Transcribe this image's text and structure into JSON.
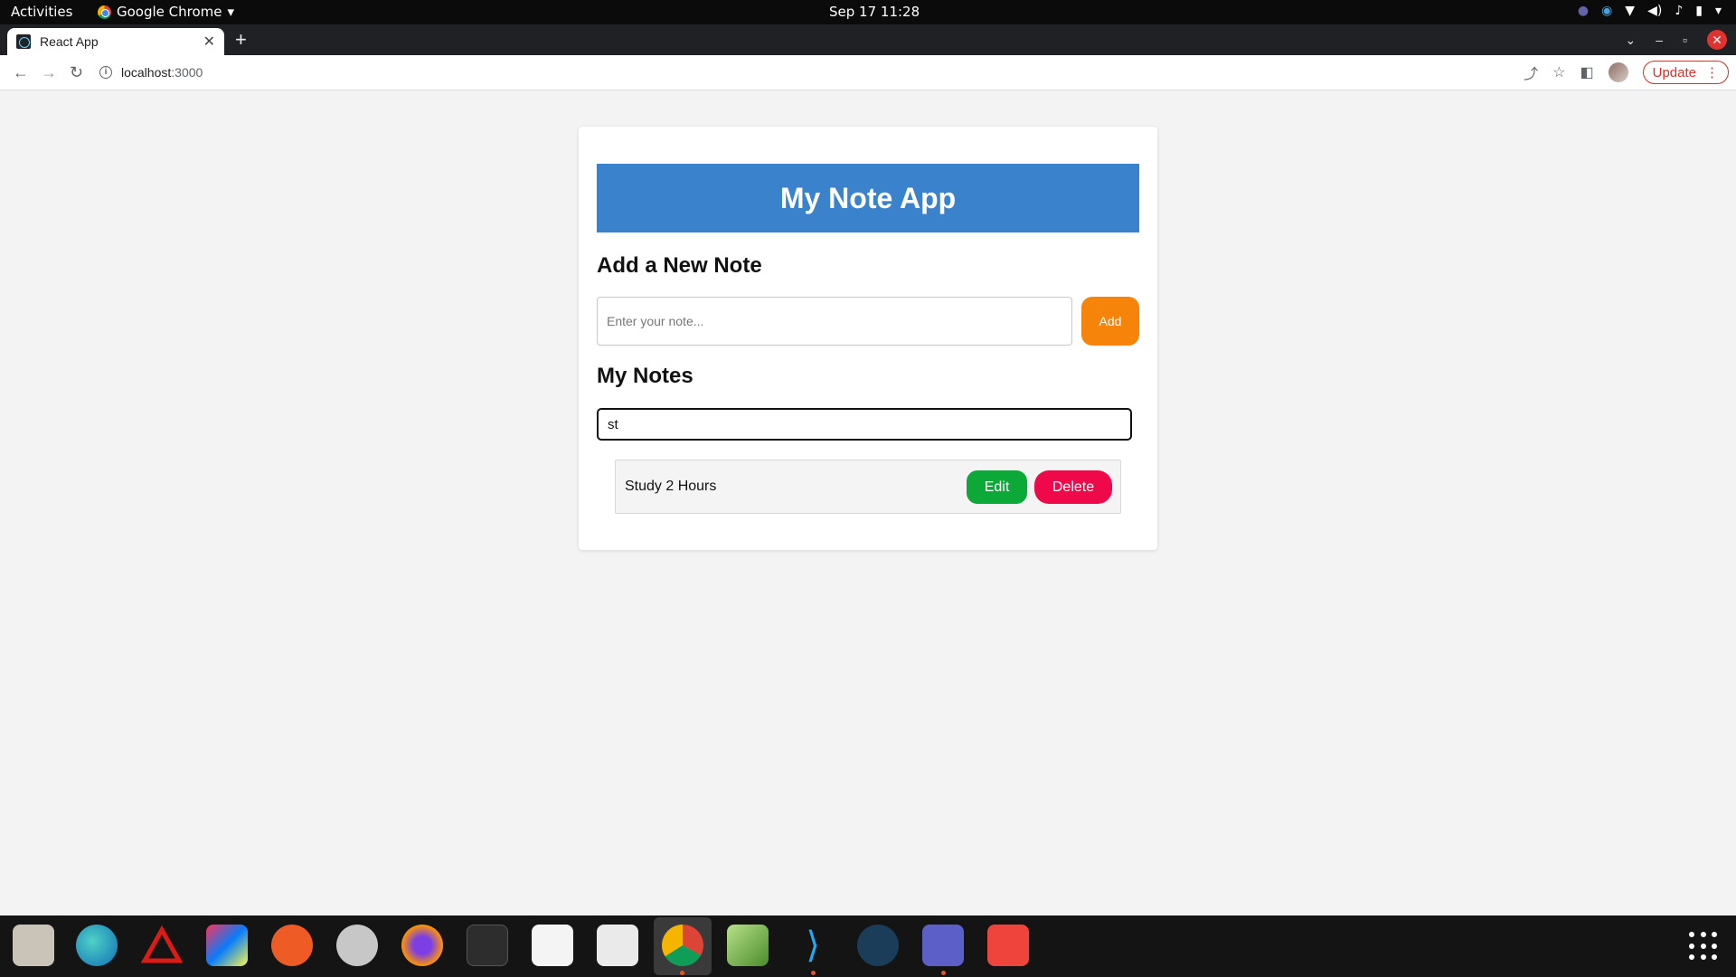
{
  "system": {
    "activities": "Activities",
    "app_menu": "Google Chrome",
    "clock": "Sep 17  11:28"
  },
  "browser": {
    "tab_title": "React App",
    "url_host": "localhost",
    "url_port": ":3000",
    "update_label": "Update"
  },
  "app": {
    "title": "My Note App",
    "add_heading": "Add a New Note",
    "note_placeholder": "Enter your note...",
    "add_button": "Add",
    "notes_heading": "My Notes",
    "search_value": "st",
    "notes": [
      {
        "text": "Study 2 Hours",
        "edit_label": "Edit",
        "delete_label": "Delete"
      }
    ]
  },
  "colors": {
    "banner": "#3b82cd",
    "add_button": "#f7840a",
    "edit_button": "#0ca838",
    "delete_button": "#f0094a"
  },
  "dock": [
    "files-icon",
    "edge-beta-icon",
    "angular-icon",
    "intellij-icon",
    "postman-icon",
    "settings-icon",
    "firefox-icon",
    "terminal-icon",
    "document-viewer-icon",
    "text-editor-icon",
    "chrome-icon",
    "image-editor-icon",
    "vscode-icon",
    "lock-app-icon",
    "teams-icon",
    "anydesk-icon"
  ]
}
